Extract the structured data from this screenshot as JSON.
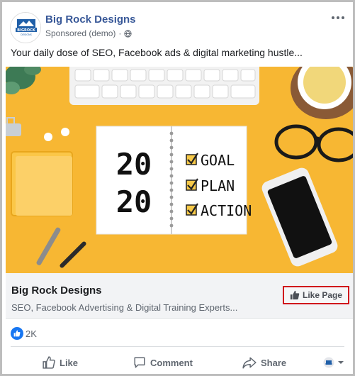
{
  "post": {
    "page_name": "Big Rock Designs",
    "sponsored_label": "Sponsored (demo)",
    "separator": "·",
    "body_text": "Your daily dose of SEO, Facebook ads & digital marketing hustle...",
    "avatar_logo_text": "BIGROCK",
    "avatar_logo_subtext": "DESIGNS"
  },
  "hero": {
    "notebook_numbers": [
      "20",
      "20"
    ],
    "checklist": [
      "GOAL",
      "PLAN",
      "ACTION"
    ],
    "background_color": "#f7b733"
  },
  "link_preview": {
    "title": "Big Rock Designs",
    "description": "SEO, Facebook Advertising & Digital Training Experts...",
    "like_page_label": "Like Page"
  },
  "reactions": {
    "count": "2K"
  },
  "actions": {
    "like": "Like",
    "comment": "Comment",
    "share": "Share"
  },
  "colors": {
    "brand_link": "#385898",
    "facebook_blue": "#1877f2",
    "highlight_red": "#d0021b"
  }
}
